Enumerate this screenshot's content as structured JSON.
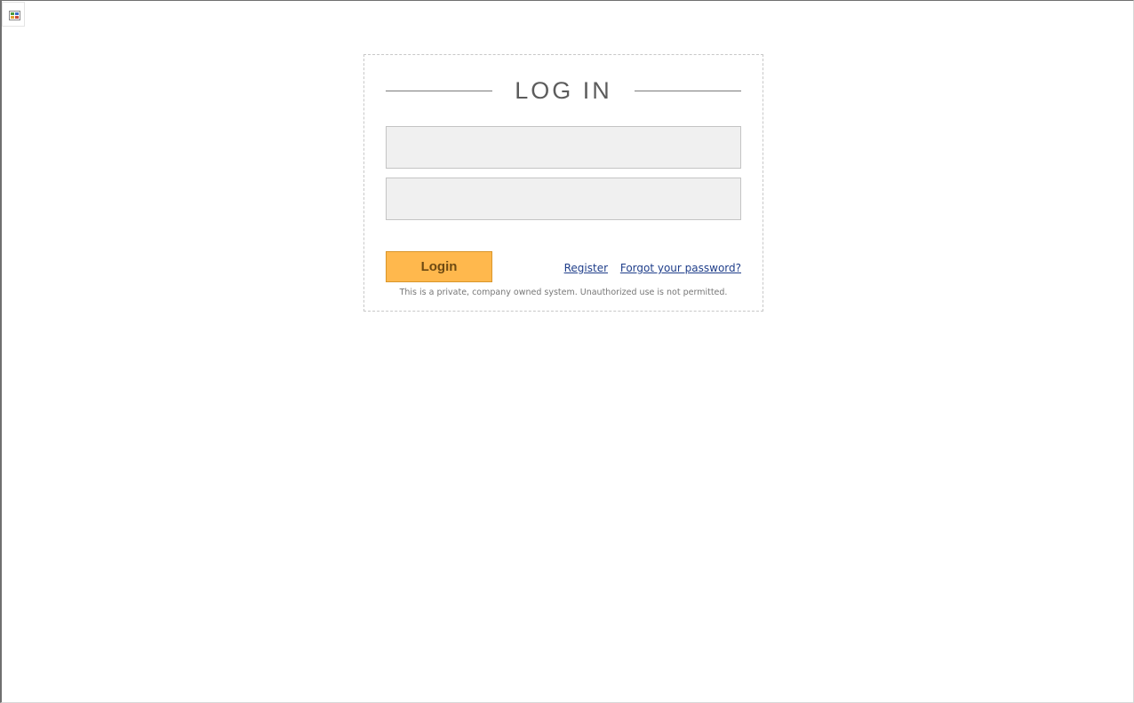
{
  "login": {
    "title": "LOG IN",
    "username_value": "",
    "password_value": "",
    "submit_label": "Login",
    "register_label": "Register",
    "forgot_label": "Forgot your password?",
    "disclaimer": "This is a private, company owned system. Unauthorized use is not permitted."
  },
  "icons": {
    "broken_image": "broken-image-icon"
  },
  "colors": {
    "button_fill": "#ffb84d",
    "button_border": "#d9962b",
    "button_text": "#6e4a12",
    "link": "#1f3e8a",
    "field_fill": "#f0f0f0",
    "title_text": "#5c5c5c"
  }
}
